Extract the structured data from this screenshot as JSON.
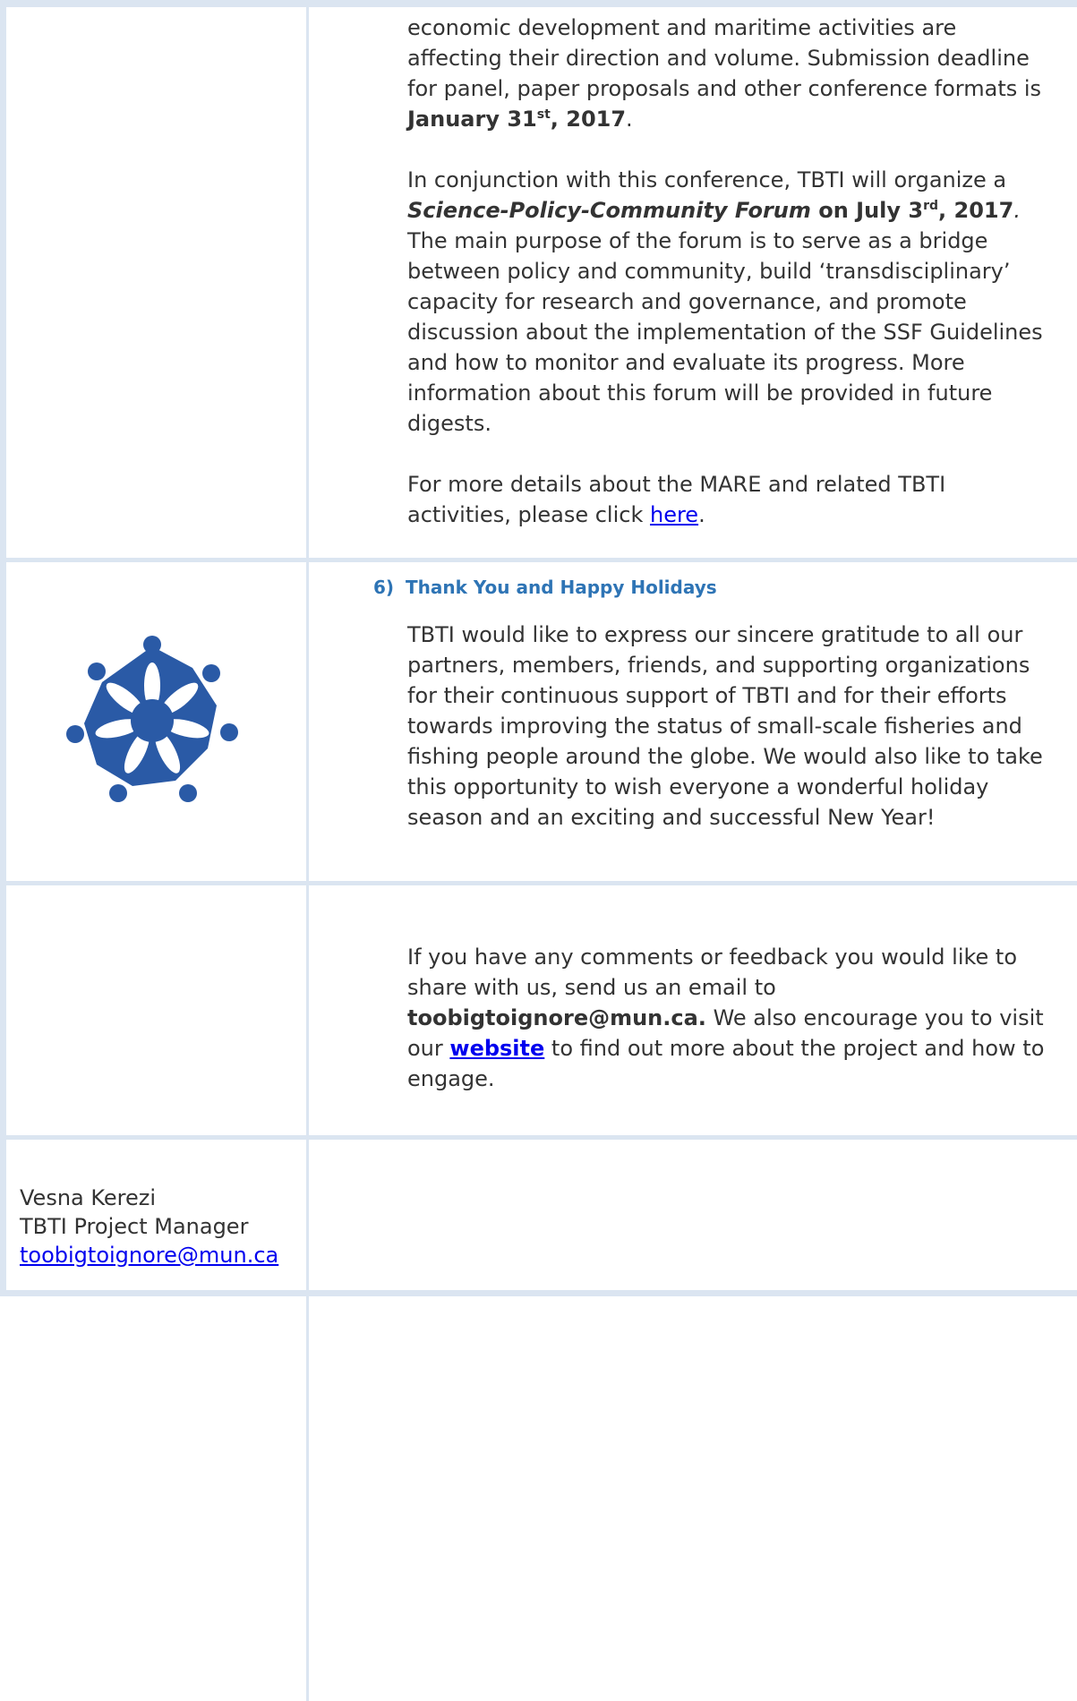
{
  "mare": {
    "p1": {
      "lead": "economic development and maritime activities are affecting their direction and volume. Submission deadline for panel, paper proposals and other conference formats is",
      "deadline_pre": "January 31",
      "deadline_sup": "st",
      "deadline_post": ", 2017",
      "end": "."
    },
    "p2": {
      "lead": "In conjunction with this conference, TBTI will organize a",
      "forum_name": "Science-Policy-Community Forum",
      "on_date_pre": " on July 3",
      "date_sup": "rd",
      "date_post": ", 2017",
      "date_end": ".",
      "body": " The main purpose of the forum is to serve as a bridge between policy and community, build ‘transdisciplinary’ capacity for research and governance, and promote discussion about the implementation of the SSF Guidelines and how to monitor and evaluate its progress. More information about this forum will be provided in future digests."
    },
    "p3": {
      "lead": "For more details about the MARE and related TBTI activities, please click ",
      "link": "here",
      "end": "."
    }
  },
  "section6": {
    "number": "6)",
    "title": "Thank You and Happy Holidays",
    "body": "TBTI would like to express our sincere gratitude to all our partners, members, friends, and supporting organizations for their continuous support of TBTI and for their efforts towards improving the status of small-scale fisheries and fishing people around the globe. We would also like to take this opportunity to wish everyone a wonderful holiday season and an exciting and successful New Year!",
    "logo_icon": "tbti-logo-icon",
    "logo_color": "#2a5aa6"
  },
  "contact": {
    "lead": "If you have any comments or feedback you would like to share with us, send us an email to ",
    "email": "toobigtoignore@mun.ca.",
    "mid": " We also encourage you to visit our ",
    "website_link": "website",
    "end": " to find out more about the project and how to engage."
  },
  "signature": {
    "name": "Vesna Kerezi",
    "role": "TBTI Project Manager",
    "email": "toobigtoignore@mun.ca"
  },
  "colors": {
    "border": "#dbe5f1",
    "heading": "#2e74b5",
    "link": "#0000ee"
  }
}
